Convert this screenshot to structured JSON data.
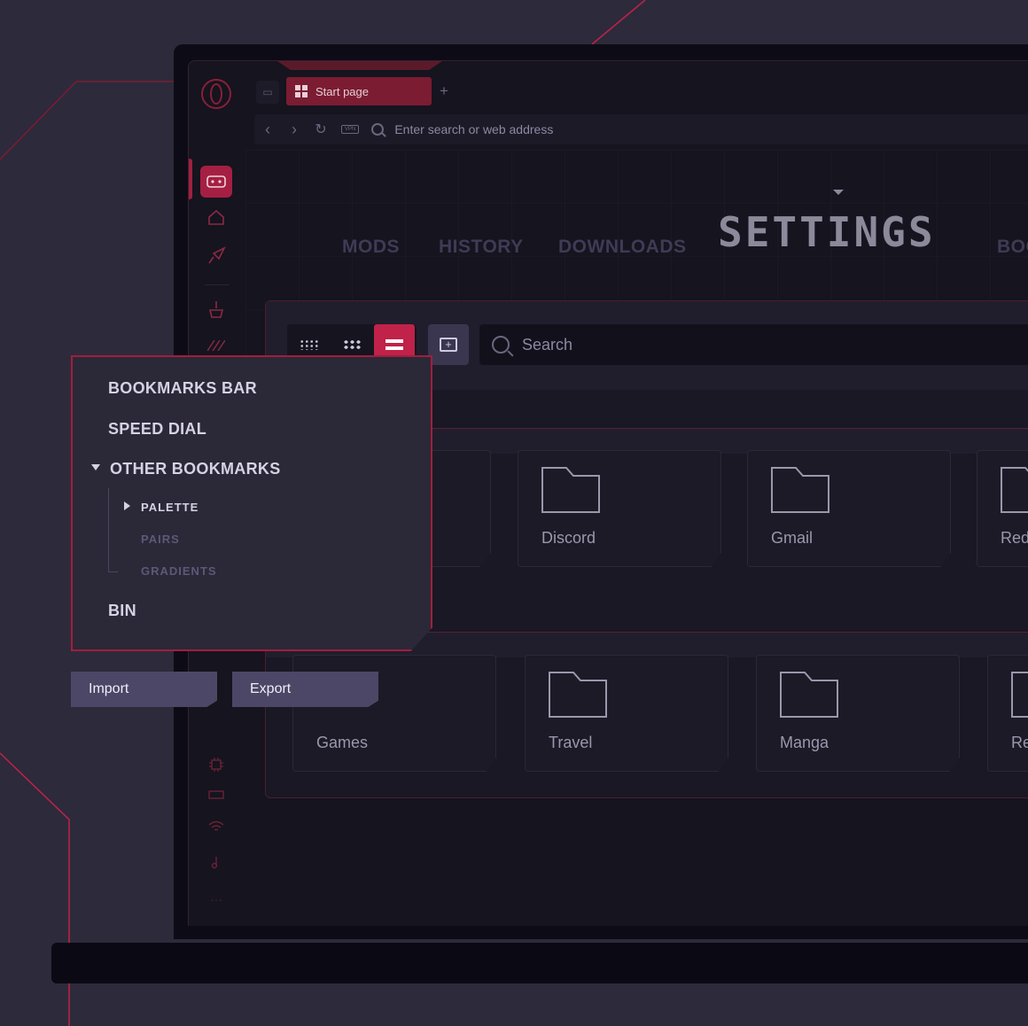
{
  "browser": {
    "tab_title": "Start page",
    "new_tab_symbol": "+",
    "address_placeholder": "Enter search or web address",
    "vpn_label": "VPN"
  },
  "nav_tabs": {
    "items": [
      "MODS",
      "HISTORY",
      "DOWNLOADS"
    ],
    "active": "SETTINGS",
    "next_partial": "BOO"
  },
  "bookmarks_panel": {
    "search_placeholder": "Search",
    "folders_row1": [
      "Discord",
      "Gmail",
      "Red"
    ],
    "folders_row2": [
      "Games",
      "Travel",
      "Manga",
      "Re"
    ]
  },
  "bookmarks_menu": {
    "items": [
      "BOOKMARKS BAR",
      "SPEED DIAL",
      "OTHER BOOKMARKS",
      "BIN"
    ],
    "sub_items": [
      "PALETTE",
      "PAIRS",
      "GRADIENTS"
    ]
  },
  "actions": {
    "import_label": "Import",
    "export_label": "Export"
  },
  "colors": {
    "accent": "#c02249",
    "background": "#2d2a3b",
    "screen": "#15141f",
    "button": "#4c4766"
  },
  "icons": {
    "sidebar": [
      "opera-logo-icon",
      "gamepad-icon",
      "home-icon",
      "rocket-icon",
      "broom-icon",
      "chip-icon",
      "ram-icon",
      "wifi-icon",
      "music-icon",
      "more-icon"
    ]
  }
}
